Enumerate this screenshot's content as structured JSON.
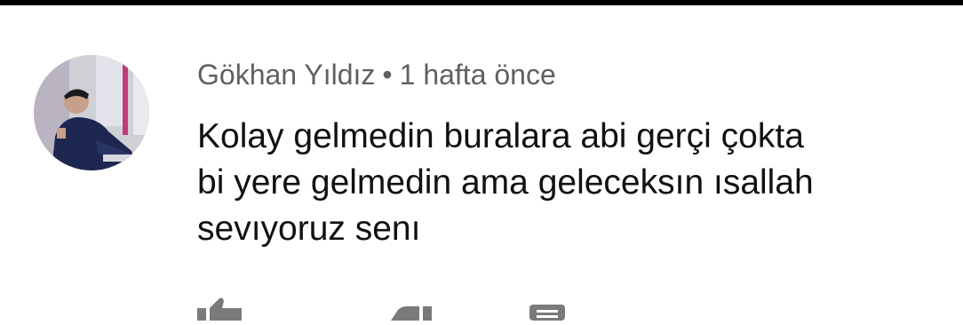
{
  "comment": {
    "author": "Gökhan Yıldız",
    "separator": "•",
    "time": "1 hafta önce",
    "text_lines": [
      "Kolay gelmedin buralara abi gerçi çokta",
      "bi yere gelmedin ama geleceksın ısallah",
      "sevıyoruz senı"
    ]
  },
  "icons": {
    "avatar": "user-avatar",
    "like": "thumbs-up-icon",
    "dislike": "thumbs-down-icon",
    "reply": "reply-icon"
  }
}
